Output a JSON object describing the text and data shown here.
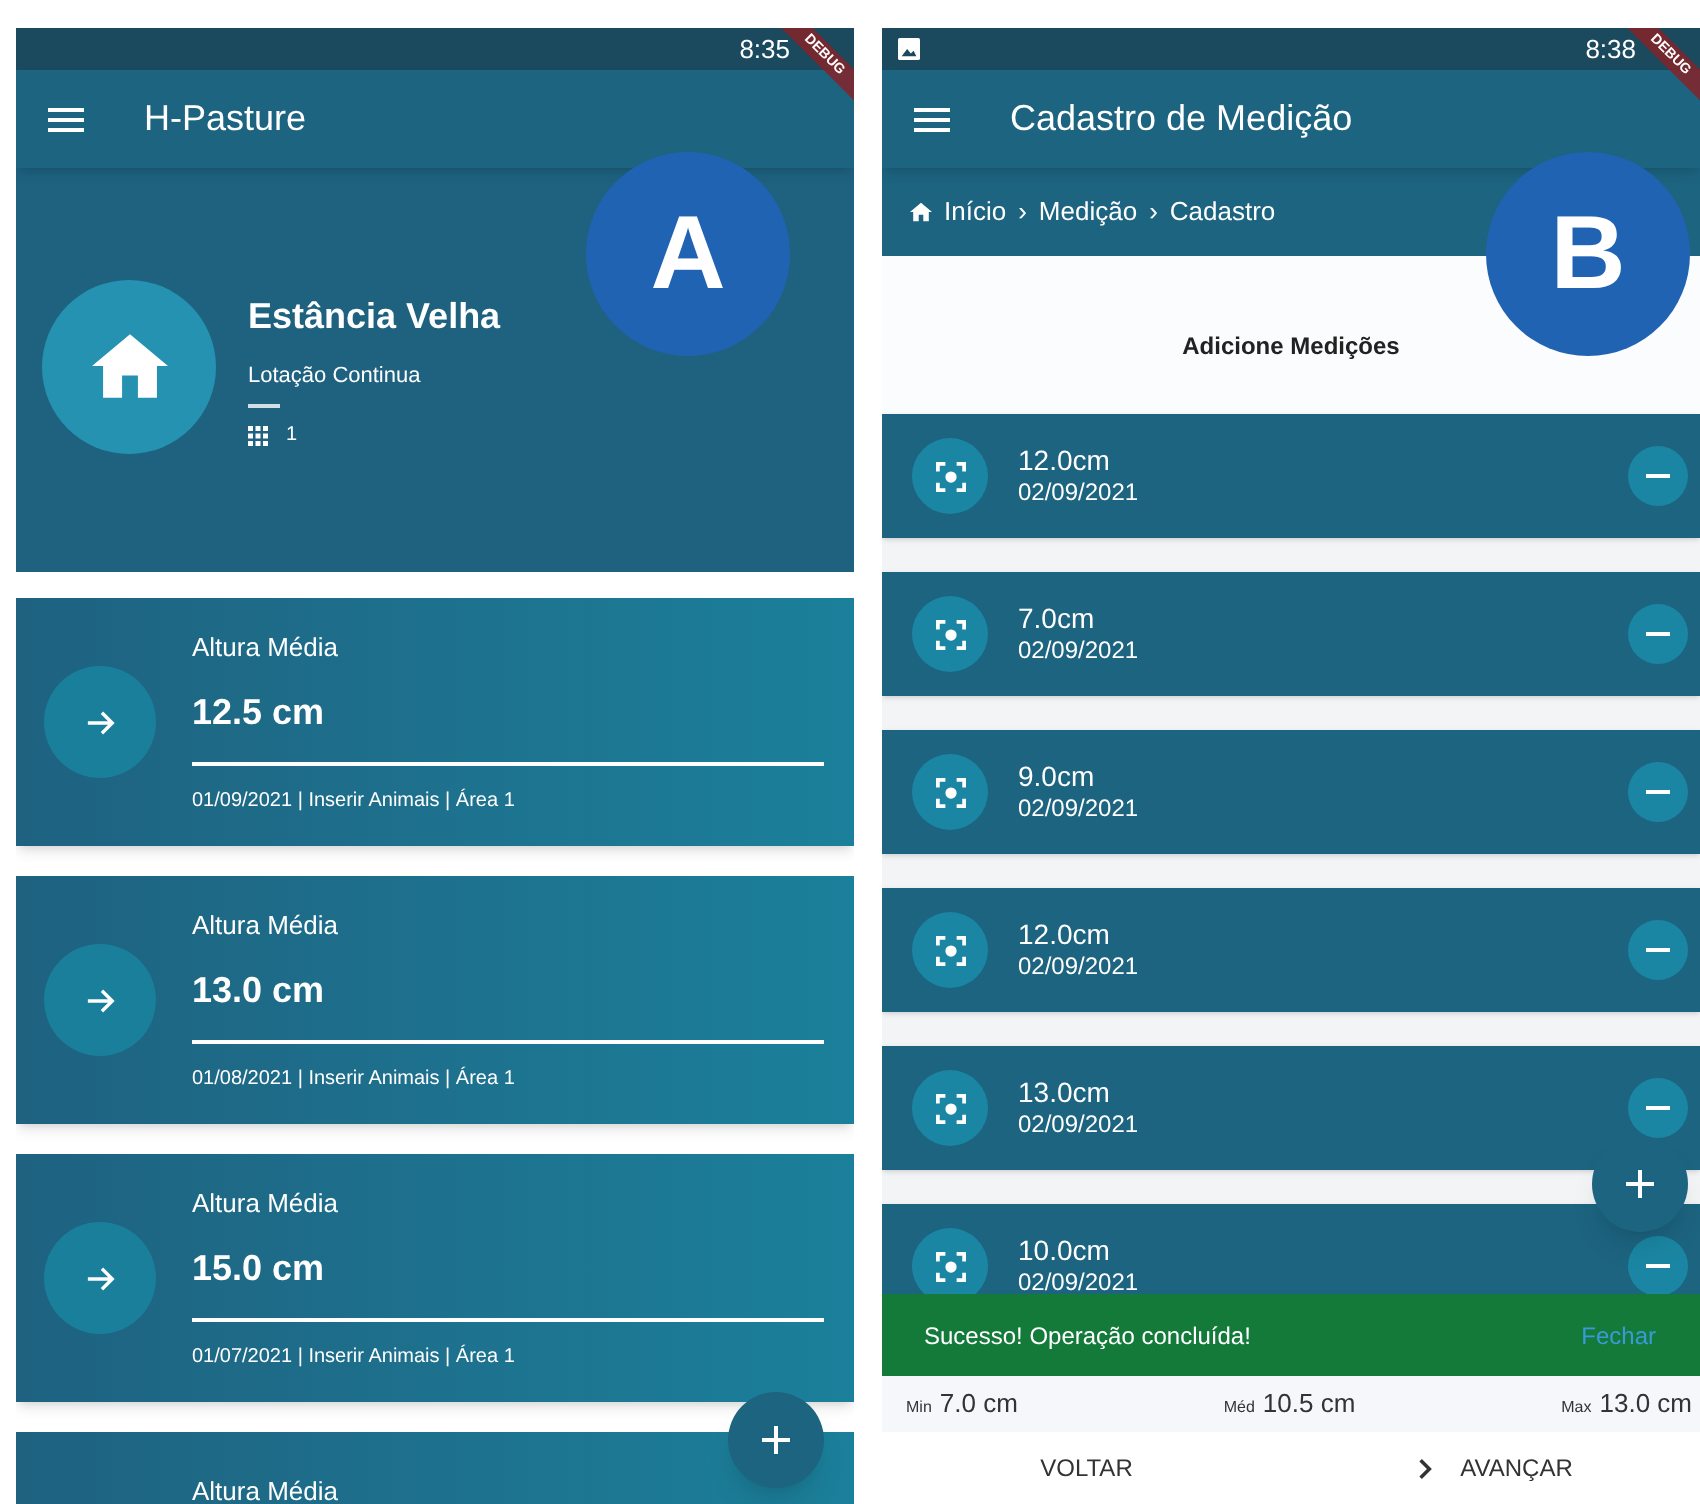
{
  "left_screen": {
    "status_bar": {
      "time": "8:35"
    },
    "debug_banner": "DEBUG",
    "app_bar": {
      "title": "H-Pasture"
    },
    "marker": "A",
    "farm": {
      "name": "Estância Velha",
      "subtitle": "Lotação Continua",
      "area_count": "1"
    },
    "cards": [
      {
        "label": "Altura Média",
        "reading": "12.5 cm",
        "meta": "01/09/2021 | Inserir Animais | Área 1"
      },
      {
        "label": "Altura Média",
        "reading": "13.0 cm",
        "meta": "01/08/2021 | Inserir Animais | Área 1"
      },
      {
        "label": "Altura Média",
        "reading": "15.0 cm",
        "meta": "01/07/2021 | Inserir Animais | Área 1"
      },
      {
        "label": "Altura Média"
      }
    ]
  },
  "right_screen": {
    "status_bar": {
      "time": "8:38"
    },
    "debug_banner": "DEBUG",
    "app_bar": {
      "title": "Cadastro de Medição"
    },
    "marker": "B",
    "breadcrumb": {
      "items": [
        "Início",
        "Medição",
        "Cadastro"
      ],
      "separator": "›"
    },
    "section_title": "Adicione Medições",
    "measurements": [
      {
        "value": "12.0cm",
        "date": "02/09/2021"
      },
      {
        "value": "7.0cm",
        "date": "02/09/2021"
      },
      {
        "value": "9.0cm",
        "date": "02/09/2021"
      },
      {
        "value": "12.0cm",
        "date": "02/09/2021"
      },
      {
        "value": "13.0cm",
        "date": "02/09/2021"
      },
      {
        "value": "10.0cm",
        "date": "02/09/2021"
      }
    ],
    "snackbar": {
      "message": "Sucesso! Operação concluída!",
      "action": "Fechar"
    },
    "stats": [
      {
        "label": "Min",
        "value": "7.0 cm"
      },
      {
        "label": "Méd",
        "value": "10.5 cm"
      },
      {
        "label": "Max",
        "value": "13.0 cm"
      }
    ],
    "buttons": [
      {
        "kind": "back",
        "label": "VOLTAR"
      },
      {
        "kind": "next",
        "label": "AVANÇAR"
      }
    ]
  }
}
